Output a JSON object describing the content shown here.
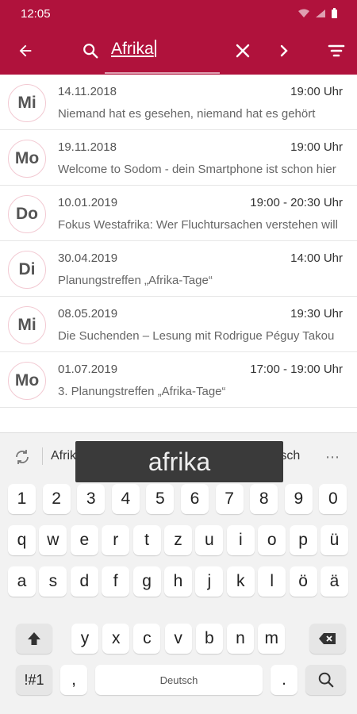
{
  "status": {
    "time": "12:05"
  },
  "search": {
    "query": "Afrika"
  },
  "events": [
    {
      "day": "Mi",
      "date": "14.11.2018",
      "time": "19:00 Uhr",
      "title": "Niemand hat es gesehen, niemand hat es gehört"
    },
    {
      "day": "Mo",
      "date": "19.11.2018",
      "time": "19:00 Uhr",
      "title": "Welcome to Sodom - dein Smartphone ist schon hier"
    },
    {
      "day": "Do",
      "date": "10.01.2019",
      "time": "19:00 - 20:30 Uhr",
      "title": "Fokus Westafrika: Wer Fluchtursachen verstehen will"
    },
    {
      "day": "Di",
      "date": "30.04.2019",
      "time": "14:00 Uhr",
      "title": "Planungstreffen „Afrika-Tage“"
    },
    {
      "day": "Mi",
      "date": "08.05.2019",
      "time": "19:30 Uhr",
      "title": "Die Suchenden – Lesung mit Rodrigue Péguy Takou"
    },
    {
      "day": "Mo",
      "date": "01.07.2019",
      "time": "17:00 - 19:00 Uhr",
      "title": "3. Planungstreffen „Afrika-Tage“"
    }
  ],
  "keyboard": {
    "suggestions": [
      "Afrikanische",
      "afrika",
      "Afrikanisch"
    ],
    "preview": "afrika",
    "row_numbers": [
      "1",
      "2",
      "3",
      "4",
      "5",
      "6",
      "7",
      "8",
      "9",
      "0"
    ],
    "row1": [
      "q",
      "w",
      "e",
      "r",
      "t",
      "z",
      "u",
      "i",
      "o",
      "p",
      "ü"
    ],
    "row2": [
      "a",
      "s",
      "d",
      "f",
      "g",
      "h",
      "j",
      "k",
      "l",
      "ö",
      "ä"
    ],
    "row3": [
      "y",
      "x",
      "c",
      "v",
      "b",
      "n",
      "m"
    ],
    "symbols_label": "!#1",
    "comma_label": ",",
    "space_label": "Deutsch",
    "period_label": "."
  },
  "colors": {
    "primary": "#b0123c",
    "circle_border": "#f2c9d2"
  }
}
